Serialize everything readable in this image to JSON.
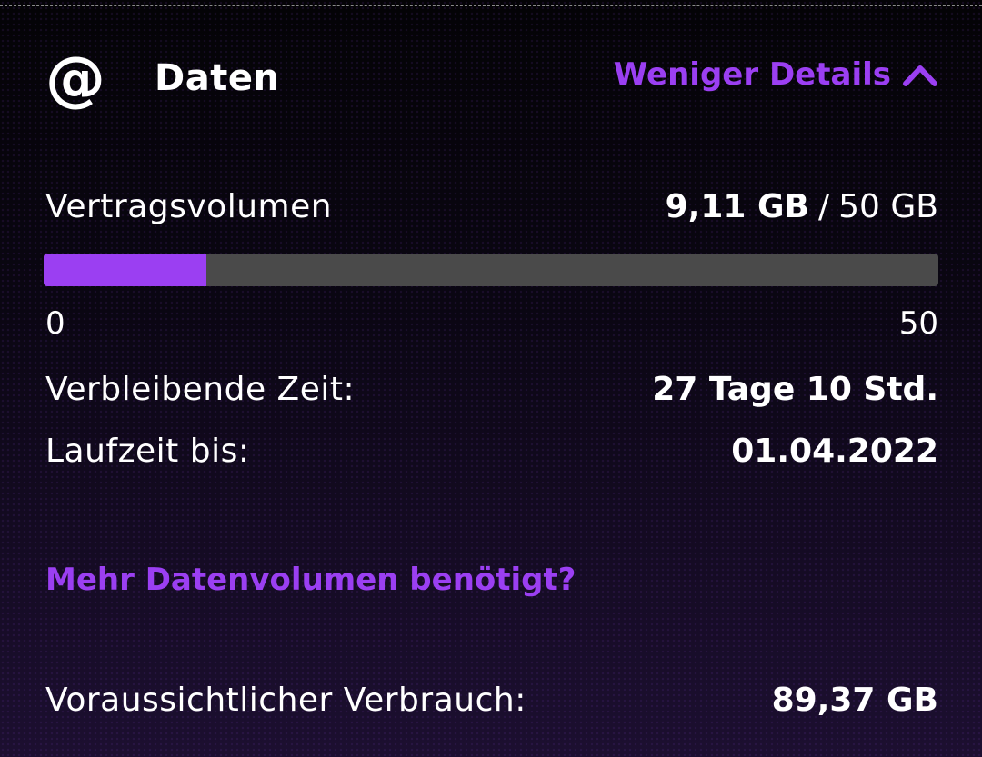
{
  "header": {
    "icon": "at-icon",
    "icon_glyph": "@",
    "title": "Daten",
    "toggle_label": "Weniger Details",
    "toggle_icon": "chevron-up-icon"
  },
  "volume": {
    "label": "Vertragsvolumen",
    "used": "9,11 GB",
    "separator": "/",
    "total": "50 GB",
    "used_gb": 9.11,
    "total_gb": 50,
    "scale_min": "0",
    "scale_max": "50"
  },
  "remaining_time": {
    "label": "Verbleibende Zeit:",
    "value": "27 Tage 10 Std."
  },
  "term_end": {
    "label": "Laufzeit bis:",
    "value": "01.04.2022"
  },
  "more_data_link": "Mehr Datenvolumen benötigt?",
  "forecast": {
    "label": "Voraussichtlicher Verbrauch:",
    "value": "89,37 GB"
  },
  "colors": {
    "accent": "#9b3ff2",
    "track": "#4a4a4a",
    "text": "#ffffff",
    "background": "#050309"
  }
}
